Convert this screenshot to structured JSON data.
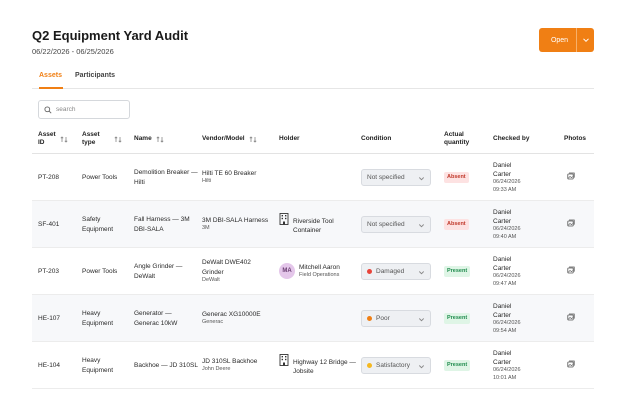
{
  "header": {
    "title": "Q2 Equipment Yard Audit",
    "dates": "06/22/2026 - 06/25/2026",
    "open_label": "Open"
  },
  "tabs": [
    {
      "label": "Assets",
      "active": true
    },
    {
      "label": "Participants",
      "active": false
    }
  ],
  "search": {
    "placeholder": "search"
  },
  "columns": {
    "asset_id": "Asset\nID",
    "asset_type": "Asset\ntype",
    "name": "Name",
    "vendor": "Vendor/Model",
    "holder": "Holder",
    "condition": "Condition",
    "quantity": "Actual\nquantity",
    "checked_by": "Checked by",
    "photos": "Photos"
  },
  "colors": {
    "accent": "#f07f14",
    "damaged": "#e8443a",
    "poor": "#f07f14",
    "satisfactory": "#f5b820"
  },
  "rows": [
    {
      "id": "PT-208",
      "type": "Power Tools",
      "name": "Demolition Breaker — Hilti",
      "model": "Hilti TE 60 Breaker",
      "vendor": "Hilti",
      "holder_kind": "none",
      "holder_name": "",
      "holder_sub": "",
      "condition": "Not specified",
      "condition_color": "",
      "quantity": "Absent",
      "checker": "Daniel Carter",
      "checked_date": "06/24/2026",
      "checked_time": "09:33 AM"
    },
    {
      "id": "SF-401",
      "type": "Safety Equipment",
      "name": "Fall Harness — 3M DBI-SALA",
      "model": "3M DBI-SALA Harness",
      "vendor": "3M",
      "holder_kind": "building",
      "holder_name": "Riverside Tool Container",
      "holder_sub": "",
      "condition": "Not specified",
      "condition_color": "",
      "quantity": "Absent",
      "checker": "Daniel Carter",
      "checked_date": "06/24/2026",
      "checked_time": "09:40 AM"
    },
    {
      "id": "PT-203",
      "type": "Power Tools",
      "name": "Angle Grinder — DeWalt",
      "model": "DeWalt DWE402 Grinder",
      "vendor": "DeWalt",
      "holder_kind": "person",
      "holder_initials": "MA",
      "holder_name": "Mitchell Aaron",
      "holder_sub": "Field Operations",
      "condition": "Damaged",
      "condition_color": "#e8443a",
      "quantity": "Present",
      "checker": "Daniel Carter",
      "checked_date": "06/24/2026",
      "checked_time": "09:47 AM"
    },
    {
      "id": "HE-107",
      "type": "Heavy Equipment",
      "name": "Generator — Generac 10kW",
      "model": "Generac XG10000E",
      "vendor": "Generac",
      "holder_kind": "none",
      "holder_name": "",
      "holder_sub": "",
      "condition": "Poor",
      "condition_color": "#f07f14",
      "quantity": "Present",
      "checker": "Daniel Carter",
      "checked_date": "06/24/2026",
      "checked_time": "09:54 AM"
    },
    {
      "id": "HE-104",
      "type": "Heavy Equipment",
      "name": "Backhoe — JD 310SL",
      "model": "JD 310SL Backhoe",
      "vendor": "John Deere",
      "holder_kind": "building",
      "holder_name": "Highway 12 Bridge — Jobsite",
      "holder_sub": "",
      "condition": "Satisfactory",
      "condition_color": "#f5b820",
      "quantity": "Present",
      "checker": "Daniel Carter",
      "checked_date": "06/24/2026",
      "checked_time": "10:01 AM"
    }
  ]
}
